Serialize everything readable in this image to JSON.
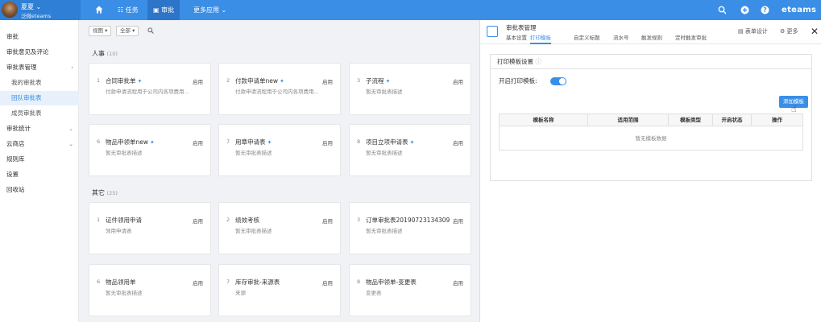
{
  "colors": {
    "topbar": "#3a8ee6",
    "accent": "#3a8ee6",
    "sidebar_active_bg": "#e8f0fb"
  },
  "user": {
    "name": "夏夏 ⌄",
    "org": "泛微eteams"
  },
  "topnav": {
    "home_icon": "home-icon",
    "items": [
      "☷ 任务",
      "▣ 审批",
      "更多应用 ⌄"
    ],
    "search_icon": "search-icon",
    "add_icon": "plus-circle-icon",
    "help_icon": "help-circle-icon",
    "brand": "eteams"
  },
  "sidebar": {
    "items": [
      {
        "label": "审批"
      },
      {
        "label": "审批意见及评论"
      },
      {
        "label": "审批表管理",
        "chevron": "›"
      },
      {
        "label": "我的审批表"
      },
      {
        "label": "团队审批表"
      },
      {
        "label": "成员审批表"
      },
      {
        "label": "审批统计",
        "chevron": "⌄"
      },
      {
        "label": "云商店",
        "chevron": "⌄"
      },
      {
        "label": "规则库"
      },
      {
        "label": "设置"
      },
      {
        "label": "回收站"
      }
    ]
  },
  "toolbar": {
    "view_label": "视图 ▾",
    "filter_label": "全部 ▾",
    "search_icon": "search-icon"
  },
  "sections": [
    {
      "title": "人事",
      "count": "(10)",
      "cards": [
        {
          "num": "1",
          "title": "合同审批单",
          "pinned": true,
          "status": "启用",
          "desc": "付款申请流程用于公司内各项费用..."
        },
        {
          "num": "2",
          "title": "付款申请单new",
          "pinned": true,
          "status": "启用",
          "desc": "付款申请流程用于公司内各项费用..."
        },
        {
          "num": "3",
          "title": "子流程",
          "pinned": true,
          "status": "启用",
          "desc": "暂无审批表描述"
        },
        {
          "num": "6",
          "title": "物品申领单new",
          "pinned": true,
          "status": "启用",
          "desc": "暂无审批表描述"
        },
        {
          "num": "7",
          "title": "用章申请表",
          "pinned": true,
          "status": "启用",
          "desc": "暂无审批表描述"
        },
        {
          "num": "8",
          "title": "项目立项申请表",
          "pinned": true,
          "status": "启用",
          "desc": "暂无审批表描述"
        }
      ]
    },
    {
      "title": "其它",
      "count": "(25)",
      "cards": [
        {
          "num": "1",
          "title": "证件领用申请",
          "pinned": false,
          "status": "启用",
          "desc": "领用申请表"
        },
        {
          "num": "2",
          "title": "绩效考核",
          "pinned": false,
          "status": "启用",
          "desc": "暂无审批表描述"
        },
        {
          "num": "3",
          "title": "订单审批表20190723134309",
          "pinned": false,
          "status": "启用",
          "desc": "暂无审批表描述"
        },
        {
          "num": "6",
          "title": "物品领用单",
          "pinned": false,
          "status": "启用",
          "desc": "暂无审批表描述"
        },
        {
          "num": "7",
          "title": "库存审批-来源表",
          "pinned": false,
          "status": "启用",
          "desc": "来源"
        },
        {
          "num": "8",
          "title": "物品申领单-变更表",
          "pinned": false,
          "status": "启用",
          "desc": "变更表"
        }
      ]
    }
  ],
  "panel": {
    "title": "审批表管理",
    "tabs": [
      "基本设置",
      "打印模板",
      "自定义标题",
      "流水号",
      "触发规则",
      "定时触发审批"
    ],
    "active_tab": 1,
    "form_design_label": "表单设计",
    "more_label": "更多",
    "close_icon": "close-icon",
    "section_title": "打印模板设置",
    "toggle_label": "开启打印模板:",
    "toggle_on": true,
    "add_button_label": "添加模板",
    "table_headers": [
      "模板名称",
      "适用范围",
      "模板类型",
      "开启状态",
      "操作"
    ],
    "empty_text": "暂无模板数据"
  }
}
